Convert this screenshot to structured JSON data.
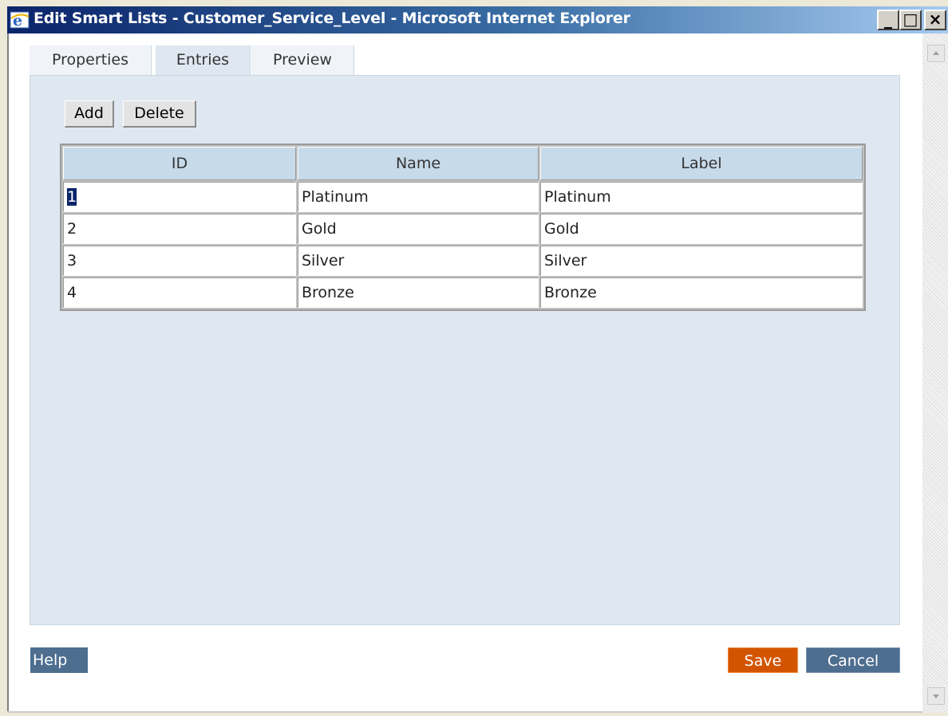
{
  "window": {
    "title": "Edit Smart Lists - Customer_Service_Level - Microsoft Internet Explorer",
    "controls": {
      "minimize": "_",
      "maximize": "□",
      "close": "×"
    }
  },
  "tabs": [
    {
      "label": "Properties",
      "active": false
    },
    {
      "label": "Entries",
      "active": true
    },
    {
      "label": "Preview",
      "active": false
    }
  ],
  "toolbar": {
    "add_label": "Add",
    "delete_label": "Delete"
  },
  "table": {
    "columns": [
      "ID",
      "Name",
      "Label"
    ],
    "rows": [
      {
        "id": "1",
        "name": "Platinum",
        "label": "Platinum"
      },
      {
        "id": "2",
        "name": "Gold",
        "label": "Gold"
      },
      {
        "id": "3",
        "name": "Silver",
        "label": "Silver"
      },
      {
        "id": "4",
        "name": "Bronze",
        "label": "Bronze"
      }
    ]
  },
  "footer": {
    "help_label": "Help",
    "save_label": "Save",
    "cancel_label": "Cancel"
  },
  "colors": {
    "title_bar_start": "#0a246a",
    "panel": "#dfe8f1",
    "header_cell": "#c6dae9",
    "save": "#d35400",
    "help_cancel": "#4d6e8f"
  }
}
